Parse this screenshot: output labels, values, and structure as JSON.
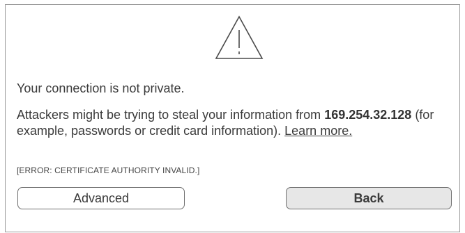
{
  "warning": {
    "icon": "warning-triangle-icon",
    "headline": "Your connection is not private.",
    "message_before": "Attackers might be trying to steal your information from ",
    "host": "169.254.32.128",
    "message_after": " (for example, passwords or credit card information). ",
    "learn_more_label": "Learn more.",
    "error_code": "[ERROR: CERTIFICATE AUTHORITY INVALID.]"
  },
  "buttons": {
    "advanced_label": "Advanced",
    "back_label": "Back"
  }
}
